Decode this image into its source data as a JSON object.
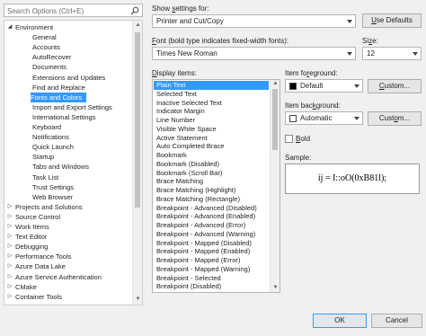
{
  "search": {
    "placeholder": "Search Options (Ctrl+E)"
  },
  "tree": {
    "items": [
      {
        "label": "Environment",
        "level": 0,
        "expander": "◢"
      },
      {
        "label": "General",
        "level": 1
      },
      {
        "label": "Accounts",
        "level": 1
      },
      {
        "label": "AutoRecover",
        "level": 1
      },
      {
        "label": "Documents",
        "level": 1
      },
      {
        "label": "Extensions and Updates",
        "level": 1
      },
      {
        "label": "Find and Replace",
        "level": 1
      },
      {
        "label": "Fonts and Colors",
        "level": 1,
        "selected": true
      },
      {
        "label": "Import and Export Settings",
        "level": 1
      },
      {
        "label": "International Settings",
        "level": 1
      },
      {
        "label": "Keyboard",
        "level": 1
      },
      {
        "label": "Notifications",
        "level": 1
      },
      {
        "label": "Quick Launch",
        "level": 1
      },
      {
        "label": "Startup",
        "level": 1
      },
      {
        "label": "Tabs and Windows",
        "level": 1
      },
      {
        "label": "Task List",
        "level": 1
      },
      {
        "label": "Trust Settings",
        "level": 1
      },
      {
        "label": "Web Browser",
        "level": 1
      },
      {
        "label": "Projects and Solutions",
        "level": 0,
        "expander": "▷"
      },
      {
        "label": "Source Control",
        "level": 0,
        "expander": "▷"
      },
      {
        "label": "Work Items",
        "level": 0,
        "expander": "▷"
      },
      {
        "label": "Text Editor",
        "level": 0,
        "expander": "▷"
      },
      {
        "label": "Debugging",
        "level": 0,
        "expander": "▷"
      },
      {
        "label": "Performance Tools",
        "level": 0,
        "expander": "▷"
      },
      {
        "label": "Azure Data Lake",
        "level": 0,
        "expander": "▷"
      },
      {
        "label": "Azure Service Authentication",
        "level": 0,
        "expander": "▷"
      },
      {
        "label": "CMake",
        "level": 0,
        "expander": "▷"
      },
      {
        "label": "Container Tools",
        "level": 0,
        "expander": "▷"
      }
    ]
  },
  "settings": {
    "show_settings_label_pre": "Show ",
    "show_settings_label_key": "s",
    "show_settings_label_post": "ettings for:",
    "show_settings_value": "Printer and Cut/Copy",
    "use_defaults_pre": "",
    "use_defaults_key": "U",
    "use_defaults_post": "se Defaults"
  },
  "font": {
    "label_key": "F",
    "label_post": "ont (bold type indicates fixed-width fonts):",
    "value": "Times New Roman",
    "size_label_pre": "Si",
    "size_label_key": "z",
    "size_label_post": "e:",
    "size_value": "12"
  },
  "display_items": {
    "label_pre": "",
    "label_key": "D",
    "label_post": "isplay items:",
    "items": [
      "Plain Text",
      "Selected Text",
      "Inactive Selected Text",
      "Indicator Margin",
      "Line Number",
      "Visible White Space",
      "Active Statement",
      "Auto Completed Brace",
      "Bookmark",
      "Bookmark (Disabled)",
      "Bookmark (Scroll Bar)",
      "Brace Matching",
      "Brace Matching (Highlight)",
      "Brace Matching (Rectangle)",
      "Breakpoint - Advanced (Disabled)",
      "Breakpoint - Advanced (Enabled)",
      "Breakpoint - Advanced (Error)",
      "Breakpoint - Advanced (Warning)",
      "Breakpoint - Mapped (Disabled)",
      "Breakpoint - Mapped (Enabled)",
      "Breakpoint - Mapped (Error)",
      "Breakpoint - Mapped (Warning)",
      "Breakpoint - Selected",
      "Breakpoint (Disabled)"
    ],
    "selected_index": 0
  },
  "foreground": {
    "label_pre": "Item fo",
    "label_key": "r",
    "label_post": "eground:",
    "value": "Default",
    "swatch_color": "#000000",
    "custom_pre": "",
    "custom_key": "C",
    "custom_post": "ustom..."
  },
  "background": {
    "label_pre": "Item bac",
    "label_key": "k",
    "label_post": "ground:",
    "value": "Automatic",
    "swatch_color": "#ffffff",
    "custom_pre": "Cust",
    "custom_key": "o",
    "custom_post": "m..."
  },
  "bold": {
    "label_key": "B",
    "label_post": "old",
    "checked": false
  },
  "sample": {
    "label": "Sample:",
    "text": "ij = I::oO(0xB81l);"
  },
  "footer": {
    "ok": "OK",
    "cancel": "Cancel"
  },
  "colors": {
    "selection": "#3399ff",
    "default_border": "#3399ff"
  }
}
